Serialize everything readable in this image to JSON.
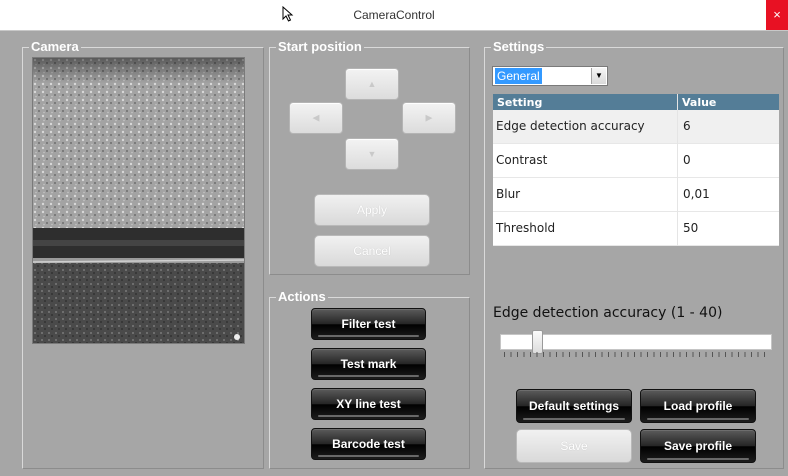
{
  "window": {
    "title": "CameraControl",
    "close_glyph": "×"
  },
  "camera": {
    "label": "Camera"
  },
  "start_position": {
    "label": "Start position",
    "arrows": {
      "up": "up-arrow-icon",
      "left": "left-arrow-icon",
      "right": "right-arrow-icon",
      "down": "down-arrow-icon"
    },
    "apply_label": "Apply",
    "cancel_label": "Cancel"
  },
  "actions": {
    "label": "Actions",
    "buttons": [
      "Filter test",
      "Test mark",
      "XY line test",
      "Barcode test"
    ]
  },
  "settings": {
    "label": "Settings",
    "category_selected": "General",
    "table": {
      "headers": [
        "Setting",
        "Value"
      ],
      "rows": [
        {
          "setting": "Edge detection accuracy",
          "value": "6"
        },
        {
          "setting": "Contrast",
          "value": "0"
        },
        {
          "setting": "Blur",
          "value": "0,01"
        },
        {
          "setting": "Threshold",
          "value": "50"
        }
      ]
    },
    "slider": {
      "label": "Edge detection accuracy (1 - 40)",
      "value": 6,
      "min": 1,
      "max": 40
    },
    "buttons": {
      "default": "Default settings",
      "load": "Load profile",
      "save": "Save",
      "save_profile": "Save profile"
    }
  },
  "colors": {
    "panel": "#a6a6a6",
    "grid_header": "#547d97",
    "close": "#e81123",
    "selection": "#3399ff"
  }
}
